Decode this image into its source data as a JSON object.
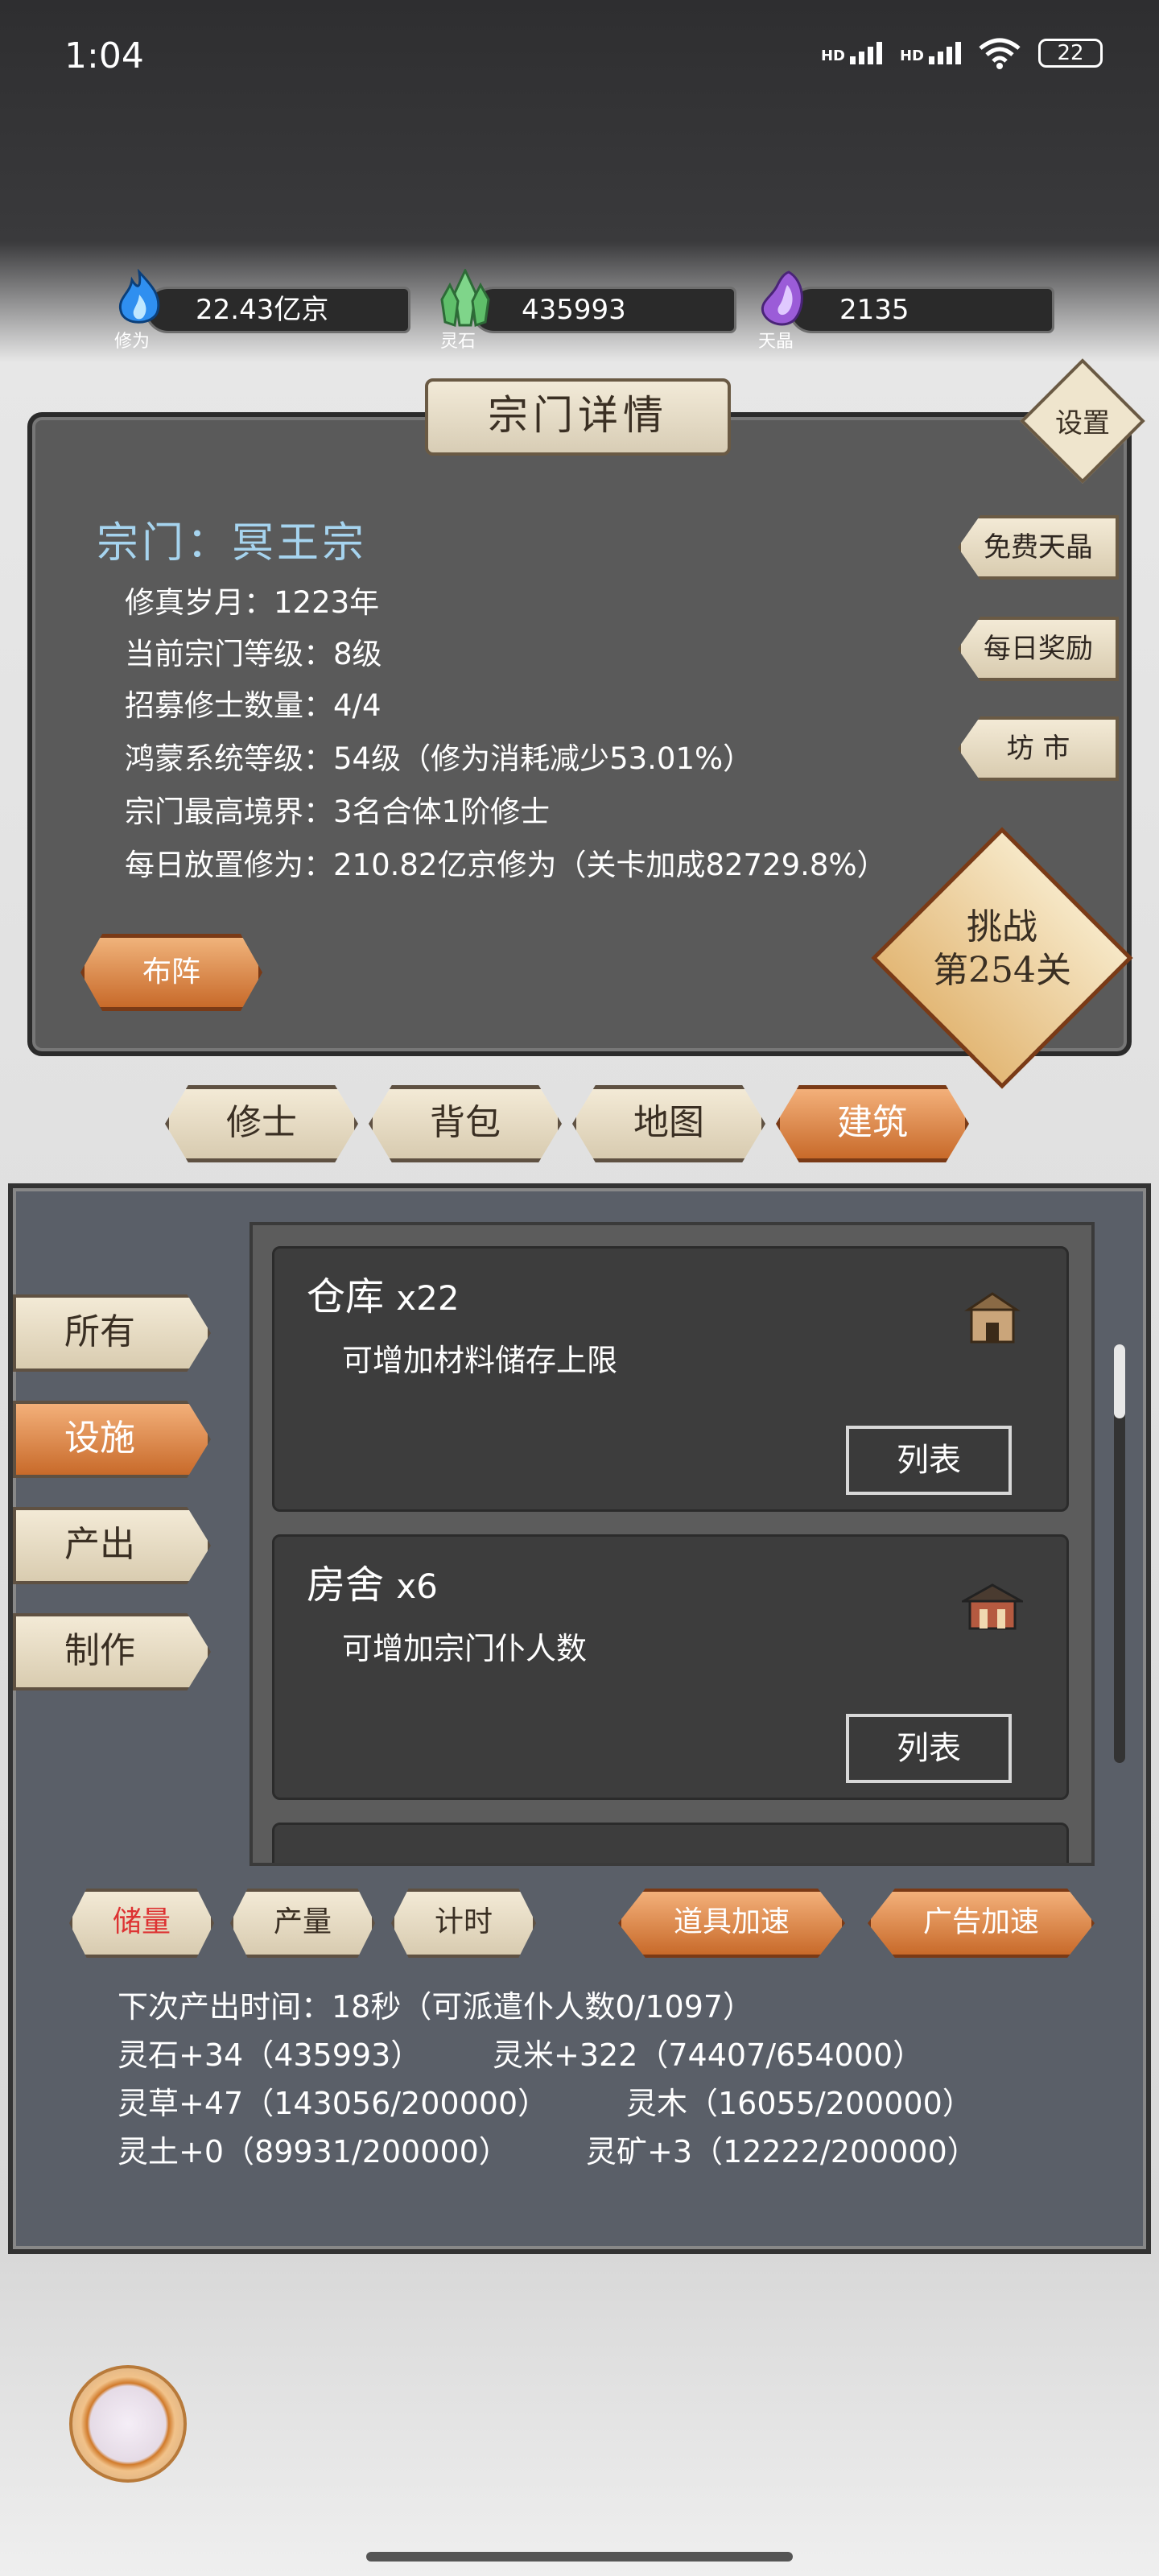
{
  "status_bar": {
    "time": "1:04",
    "net1": "HD",
    "net2": "HD",
    "battery": "22"
  },
  "resources": [
    {
      "label": "修为",
      "value": "22.43亿京",
      "color": "#3aa0ff",
      "icon": "flame-icon"
    },
    {
      "label": "灵石",
      "value": "435993",
      "color": "#5fbf6a",
      "icon": "crystal-icon"
    },
    {
      "label": "天晶",
      "value": "2135",
      "color": "#9b5cd8",
      "icon": "amethyst-icon"
    }
  ],
  "panel": {
    "title": "宗门详情",
    "settings": "设置",
    "sect_name": "宗门：冥王宗",
    "lines": [
      "修真岁月：1223年",
      "当前宗门等级：8级",
      "招募修士数量：4/4",
      "鸿蒙系统等级：54级（修为消耗减少53.01%）",
      "宗门最高境界：3名合体1阶修士",
      "每日放置修为：210.82亿京修为（关卡加成82729.8%）"
    ],
    "side_buttons": [
      "免费天晶",
      "每日奖励",
      "坊 市"
    ],
    "formation": "布阵",
    "challenge_line1": "挑战",
    "challenge_line2": "第254关"
  },
  "tabs": [
    "修士",
    "背包",
    "地图",
    "建筑"
  ],
  "categories": [
    "所有",
    "设施",
    "产出",
    "制作"
  ],
  "buildings": [
    {
      "name": "仓库",
      "count": "x22",
      "desc": "可增加材料储存上限",
      "button": "列表"
    },
    {
      "name": "房舍",
      "count": "x6",
      "desc": "可增加宗门仆人数",
      "button": "列表"
    }
  ],
  "sub_buttons": [
    "储量",
    "产量",
    "计时",
    "道具加速",
    "广告加速"
  ],
  "stats": {
    "next": "下次产出时间：18秒（可派遣仆人数0/1097）",
    "row1_left": "灵石+34（435993）",
    "row1_right": "灵米+322（74407/654000）",
    "row2_left": "灵草+47（143056/200000）",
    "row2_right": "灵木（16055/200000）",
    "row3_left": "灵土+0（89931/200000）",
    "row3_right": "灵矿+3（12222/200000）"
  }
}
